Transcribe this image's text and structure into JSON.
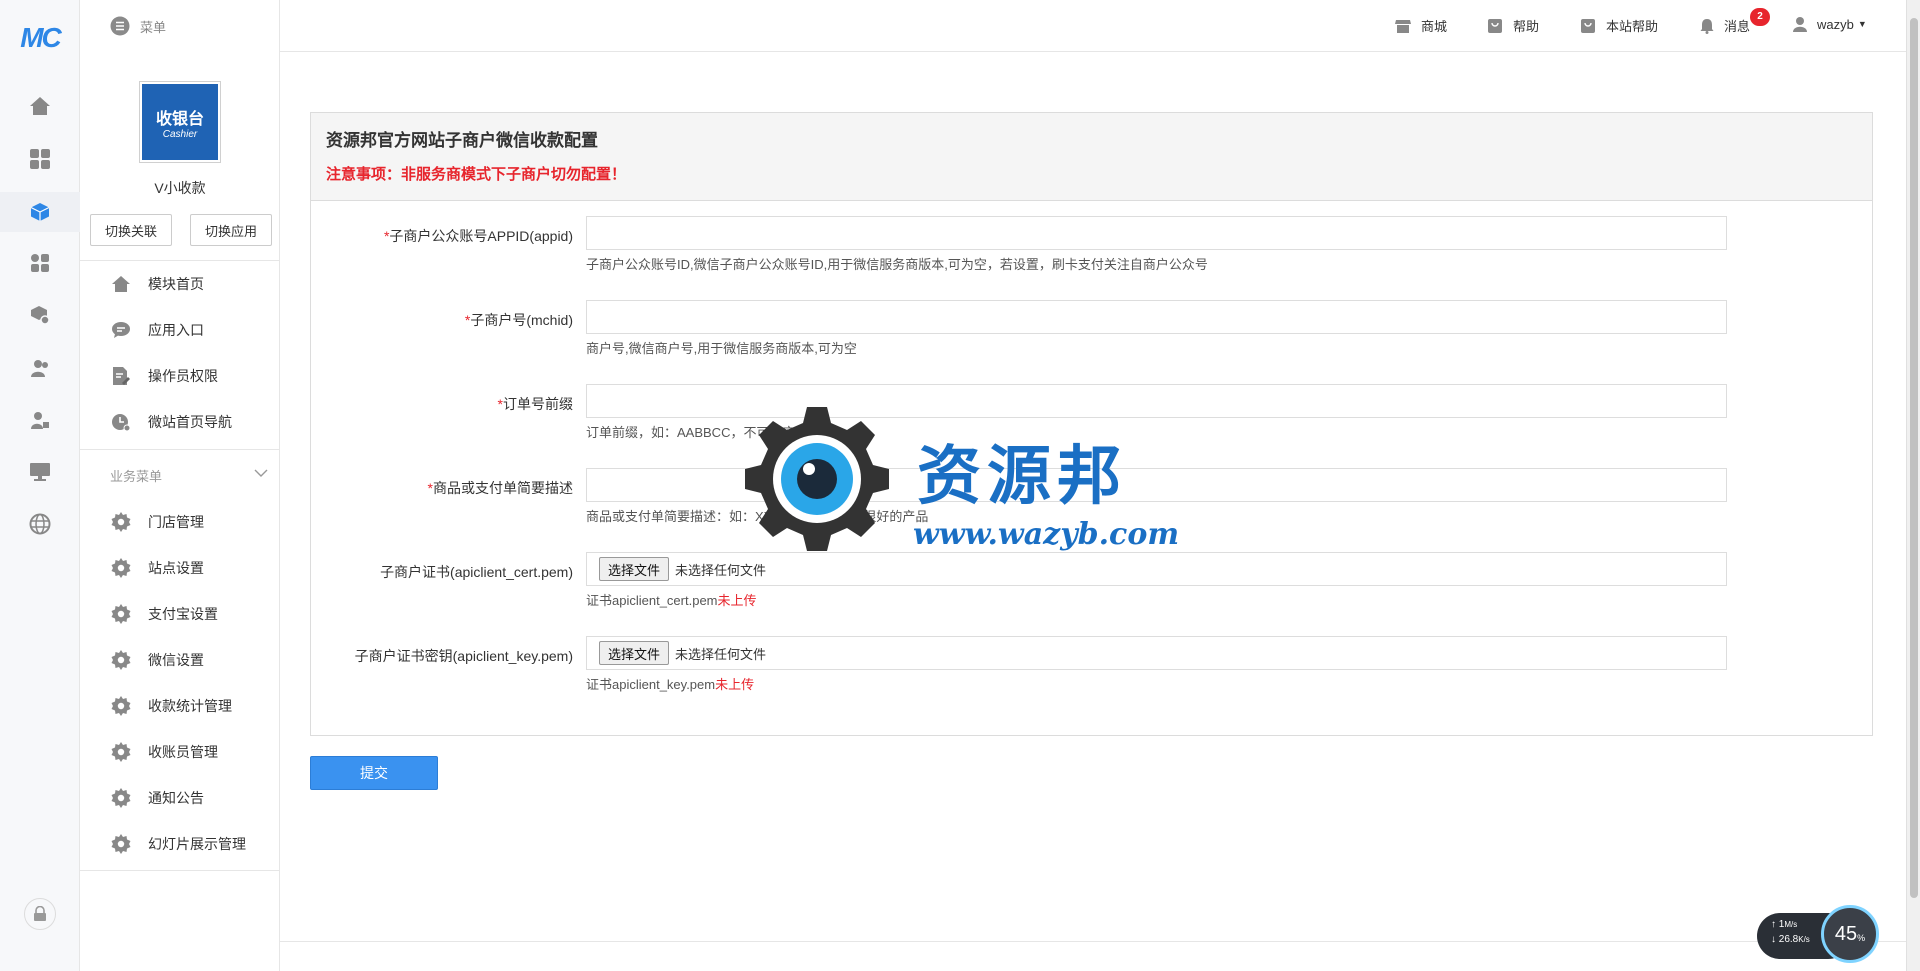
{
  "brand": {
    "logo_text": "MC"
  },
  "sidebar": {
    "menu_label": "菜单",
    "app_logo": {
      "title": "收银台",
      "subtitle": "Cashier"
    },
    "app_name": "V小收款",
    "switch_link_label": "切换关联",
    "switch_app_label": "切换应用",
    "main_items": [
      {
        "label": "模块首页",
        "icon": "home-icon"
      },
      {
        "label": "应用入口",
        "icon": "chat-icon"
      },
      {
        "label": "操作员权限",
        "icon": "edit-doc-icon"
      },
      {
        "label": "微站首页导航",
        "icon": "clock-icon"
      }
    ],
    "business_menu_label": "业务菜单",
    "business_items": [
      {
        "label": "门店管理",
        "icon": "gear-icon"
      },
      {
        "label": "站点设置",
        "icon": "gear-icon"
      },
      {
        "label": "支付宝设置",
        "icon": "gear-icon"
      },
      {
        "label": "微信设置",
        "icon": "gear-icon"
      },
      {
        "label": "收款统计管理",
        "icon": "gear-icon"
      },
      {
        "label": "收账员管理",
        "icon": "gear-icon"
      },
      {
        "label": "通知公告",
        "icon": "gear-icon"
      },
      {
        "label": "幻灯片展示管理",
        "icon": "gear-icon"
      }
    ]
  },
  "topbar": {
    "mall_label": "商城",
    "help_label": "帮助",
    "site_help_label": "本站帮助",
    "messages_label": "消息",
    "messages_count": "2",
    "username": "wazyb"
  },
  "panel": {
    "title": "资源邦官方网站子商户微信收款配置",
    "warning": "注意事项：非服务商模式下子商户切勿配置！",
    "fields": [
      {
        "label": "子商户公众账号APPID(appid)",
        "required": "*",
        "help": "子商户公众账号ID,微信子商户公众账号ID,用于微信服务商版本,可为空，若设置，刷卡支付关注自商户公众号"
      },
      {
        "label": "子商户号(mchid)",
        "required": "*",
        "help": "商户号,微信商户号,用于微信服务商版本,可为空"
      },
      {
        "label": "订单号前缀",
        "required": "*",
        "help": "订单前缀，如：AABBCC，不可为空"
      },
      {
        "label": "商品或支付单简要描述",
        "required": "*",
        "help": "商品或支付单简要描述：如：XX企业产品订单，很好的产品"
      }
    ],
    "files": [
      {
        "label": "子商户证书(apiclient_cert.pem)",
        "button": "选择文件",
        "status": "未选择任何文件",
        "help": "证书apiclient_cert.pem",
        "help_status": "未上传"
      },
      {
        "label": "子商户证书密钥(apiclient_key.pem)",
        "button": "选择文件",
        "status": "未选择任何文件",
        "help": "证书apiclient_key.pem",
        "help_status": "未上传"
      }
    ],
    "submit_label": "提交"
  },
  "watermark": {
    "cn": "资源邦",
    "en": "www.wazyb.com"
  },
  "speed_widget": {
    "upload": "1",
    "upload_unit": "M/s",
    "download": "26.8",
    "download_unit": "K/s",
    "percent": "45",
    "percent_unit": "%"
  },
  "colors": {
    "accent": "#3a92f0",
    "warning": "#e7252d",
    "brand": "#2e87e6"
  }
}
